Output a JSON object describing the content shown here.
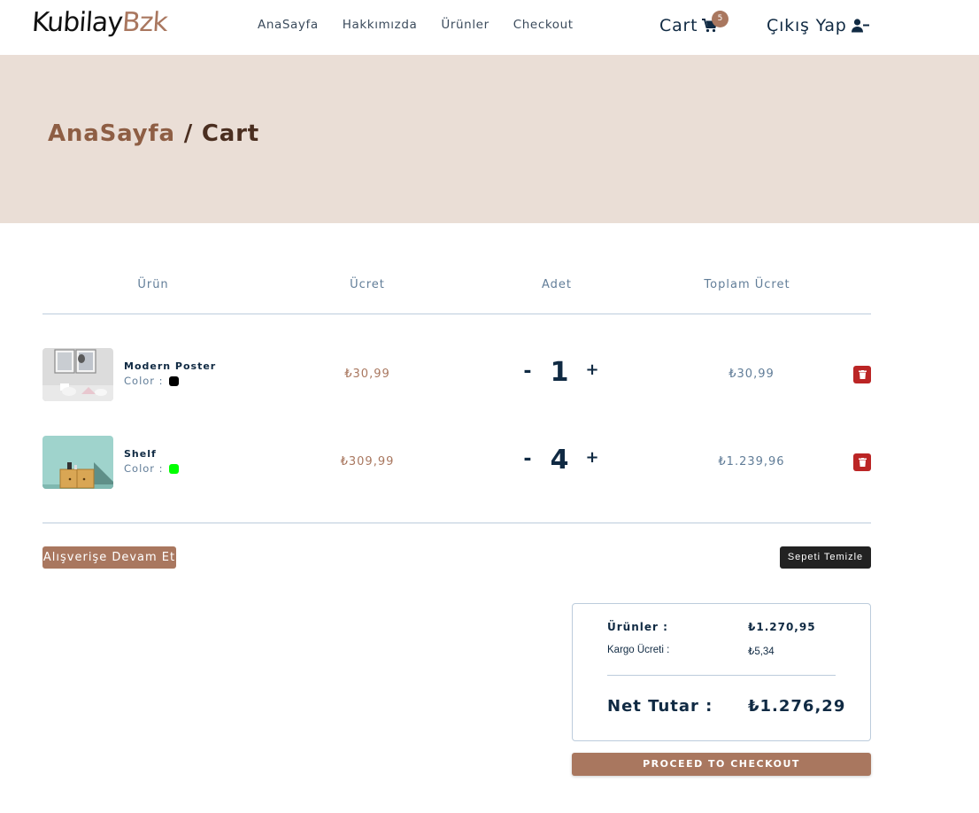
{
  "brand": {
    "logo_part1": "Kubilay",
    "logo_part2": "Bzk"
  },
  "nav": {
    "links": [
      "AnaSayfa",
      "Hakkımızda",
      "Ürünler",
      "Checkout"
    ],
    "cart_label": "Cart",
    "cart_count": "5",
    "logout_label": "Çıkış Yap"
  },
  "hero": {
    "breadcrumb_home": "AnaSayfa",
    "breadcrumb_sep": " / ",
    "breadcrumb_current": "Cart"
  },
  "table": {
    "headers": [
      "Ürün",
      "Ücret",
      "Adet",
      "Toplam Ücret"
    ],
    "color_label": "Color :",
    "rows": [
      {
        "name": "Modern Poster",
        "color": "#000000",
        "price": "₺30,99",
        "quantity": "1",
        "total": "₺30,99"
      },
      {
        "name": "Shelf",
        "color": "#00ff00",
        "price": "₺309,99",
        "quantity": "4",
        "total": "₺1.239,96"
      }
    ],
    "minus": "-",
    "plus": "+"
  },
  "actions": {
    "continue_label": "Alışverişe Devam Et",
    "clear_label": "Sepeti Temizle"
  },
  "summary": {
    "items_label": "Ürünler :",
    "items_value": "₺1.270,95",
    "shipping_label": "Kargo Ücreti :",
    "shipping_value": "₺5,34",
    "net_label": "Net Tutar :",
    "net_value": "₺1.276,29",
    "checkout_label": "PROCEED TO CHECKOUT"
  },
  "colors": {
    "accent": "#a9775f",
    "hero_bg": "#eaded6",
    "danger": "#bb2525",
    "text": "#102a43"
  }
}
